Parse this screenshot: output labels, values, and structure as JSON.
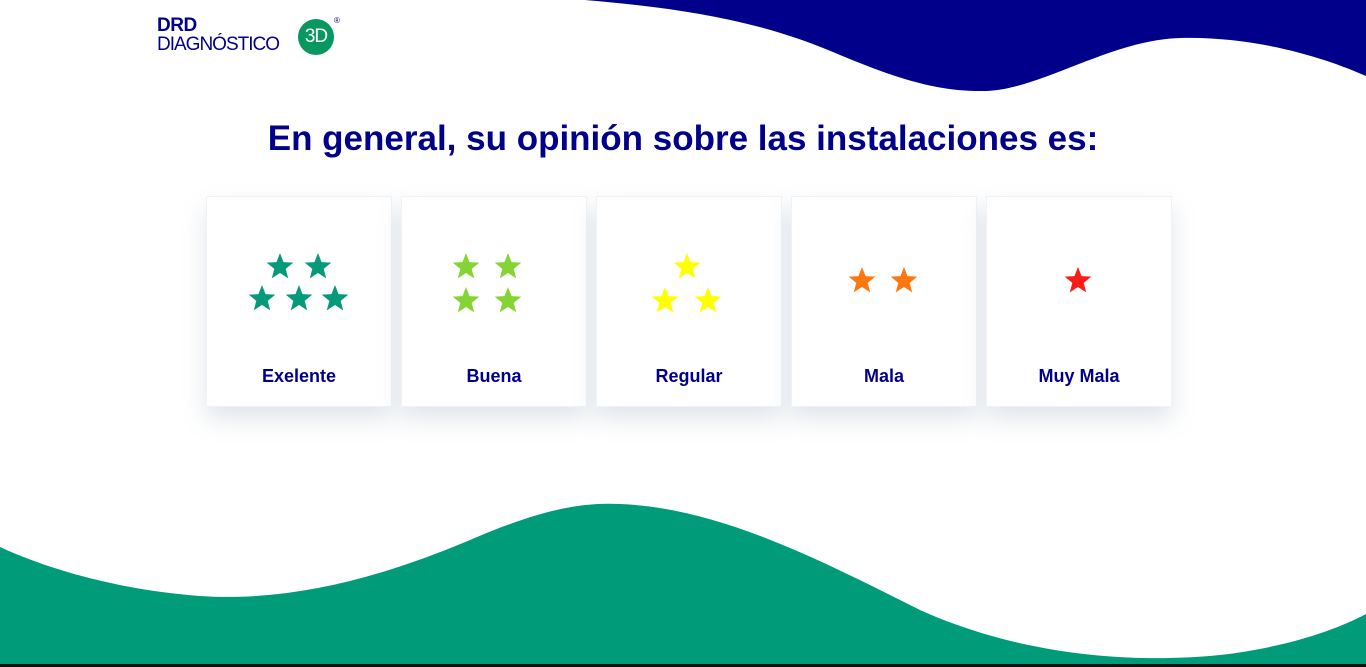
{
  "logo": {
    "line1": "DRD",
    "line2": "DIAGNÓSTICO",
    "badge": "3D",
    "registered": "®"
  },
  "question": "En general, su opinión sobre las instalaciones es:",
  "colors": {
    "primary_navy": "#00008b",
    "accent_green": "#009b78",
    "logo_green": "#07975f"
  },
  "options": [
    {
      "label": "Exelente",
      "stars": 5,
      "color": "#069a7a",
      "icon": "star-icon"
    },
    {
      "label": "Buena",
      "stars": 4,
      "color": "#84d534",
      "icon": "star-icon"
    },
    {
      "label": "Regular",
      "stars": 3,
      "color": "#ffff00",
      "icon": "star-icon"
    },
    {
      "label": "Mala",
      "stars": 2,
      "color": "#ff7710",
      "icon": "star-icon"
    },
    {
      "label": "Muy Mala",
      "stars": 1,
      "color": "#ff1a1a",
      "icon": "star-icon"
    }
  ]
}
